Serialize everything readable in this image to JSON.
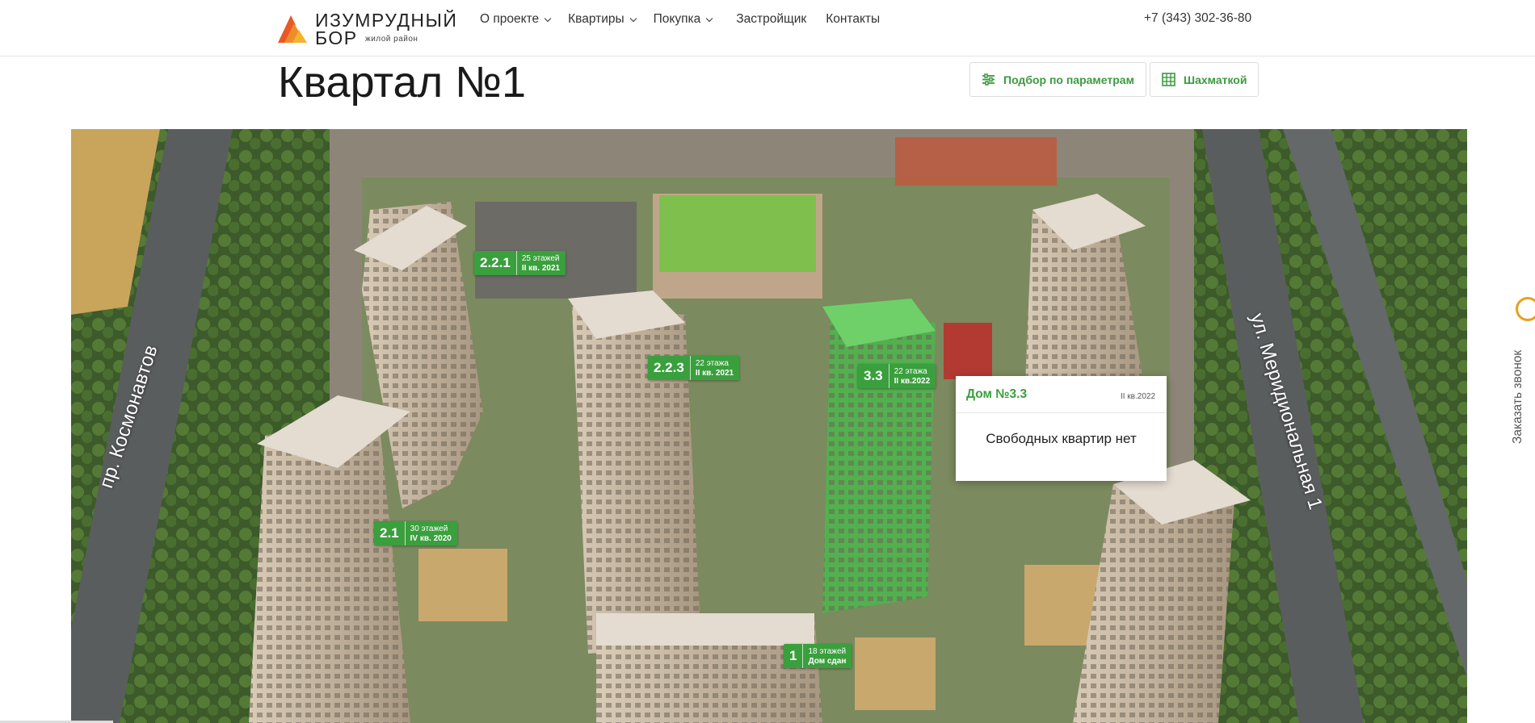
{
  "header": {
    "logo": {
      "title_line1": "ИЗУМРУДНЫЙ",
      "title_line2": "БОР",
      "subtitle": "жилой район"
    },
    "nav": [
      {
        "label": "О проекте",
        "dropdown": true
      },
      {
        "label": "Квартиры",
        "dropdown": true
      },
      {
        "label": "Покупка",
        "dropdown": true
      },
      {
        "label": "Застройщик",
        "dropdown": false
      },
      {
        "label": "Контакты",
        "dropdown": false
      }
    ],
    "phone": "+7 (343) 302-36-80"
  },
  "page": {
    "title": "Квартал №1",
    "buttons": {
      "params_label": "Подбор по параметрам",
      "chess_label": "Шахматкой"
    }
  },
  "map": {
    "street_left": "пр. Космонавтов",
    "street_right": "ул. Меридиональная 1",
    "buildings": [
      {
        "id": "2.2.1",
        "floors": "25 этажей",
        "date": "II кв. 2021"
      },
      {
        "id": "2.2.3",
        "floors": "22 этажа",
        "date": "II кв. 2021"
      },
      {
        "id": "3.3",
        "floors": "22 этажа",
        "date": "II кв.2022"
      },
      {
        "id": "2.1",
        "floors": "30 этажей",
        "date": "IV кв. 2020"
      },
      {
        "id": "1",
        "floors": "18 этажей",
        "date": "Дом сдан"
      }
    ],
    "popup": {
      "title": "Дом №3.3",
      "date": "II кв.2022",
      "message": "Свободных квартир нет"
    }
  },
  "callback": {
    "label": "Заказать звонок"
  },
  "colors": {
    "accent_green": "#3a9f3d",
    "logo_orange": "#e8662a",
    "callback_orange": "#e7a21b"
  }
}
